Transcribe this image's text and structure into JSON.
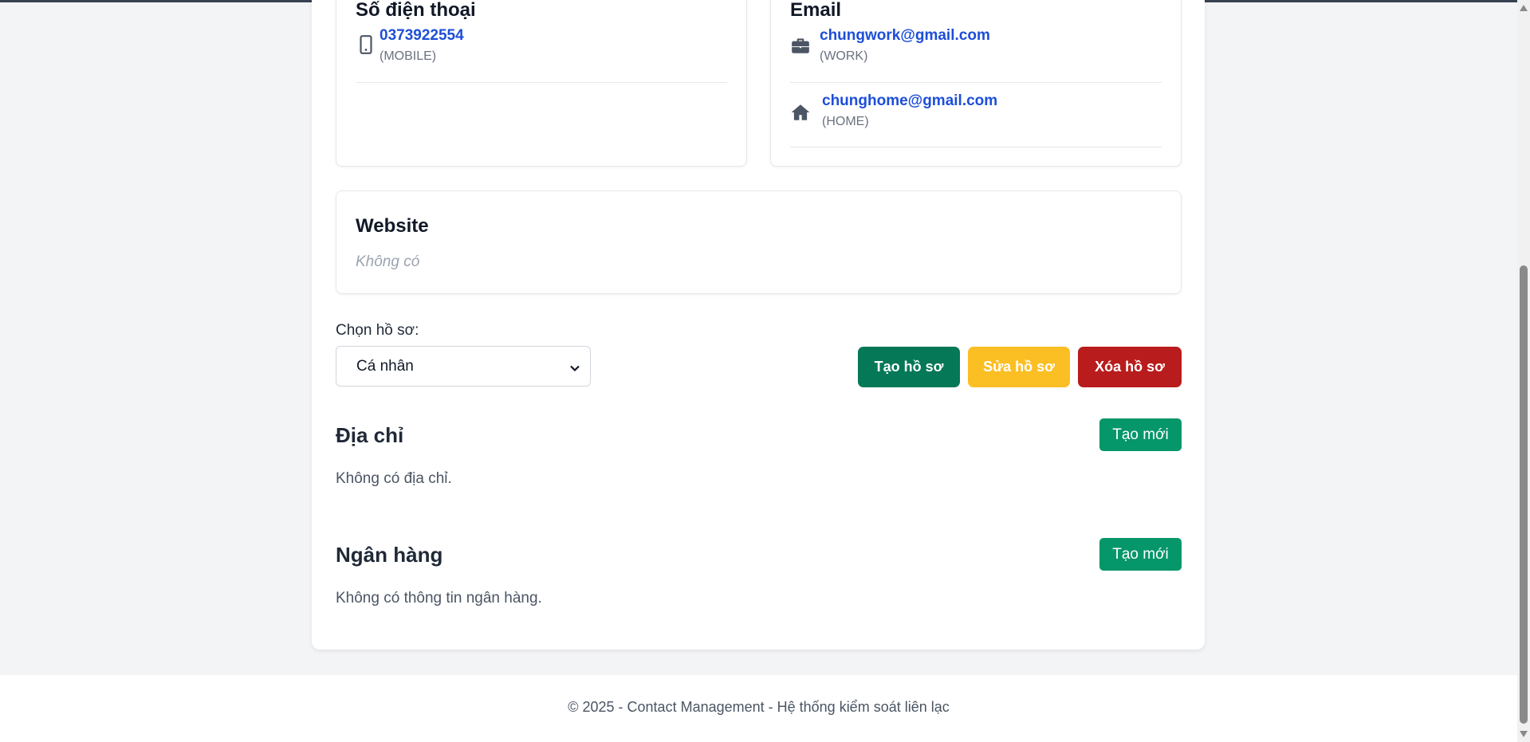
{
  "phone_panel": {
    "title": "Số điện thoại",
    "items": [
      {
        "value": "0373922554",
        "type": "(MOBILE)",
        "icon": "mobile-phone-icon"
      }
    ]
  },
  "email_panel": {
    "title": "Email",
    "items": [
      {
        "value": "chungwork@gmail.com",
        "type": "(WORK)",
        "icon": "briefcase-icon"
      },
      {
        "value": "chunghome@gmail.com",
        "type": "(HOME)",
        "icon": "home-icon"
      }
    ]
  },
  "website_panel": {
    "title": "Website",
    "empty_text": "Không có"
  },
  "profile": {
    "label": "Chọn hồ sơ:",
    "selected": "Cá nhân",
    "create_label": "Tạo hồ sơ",
    "edit_label": "Sửa hồ sơ",
    "delete_label": "Xóa hồ sơ"
  },
  "address": {
    "title": "Địa chỉ",
    "new_label": "Tạo mới",
    "empty_text": "Không có địa chỉ."
  },
  "bank": {
    "title": "Ngân hàng",
    "new_label": "Tạo mới",
    "empty_text": "Không có thông tin ngân hàng."
  },
  "footer": {
    "text": "© 2025 - Contact Management - Hệ thống kiểm soát liên lạc"
  },
  "colors": {
    "link": "#1d4ed8",
    "create_profile": "#047857",
    "edit_profile": "#fbbf24",
    "delete_profile": "#b91c1c",
    "new_button": "#059669"
  }
}
